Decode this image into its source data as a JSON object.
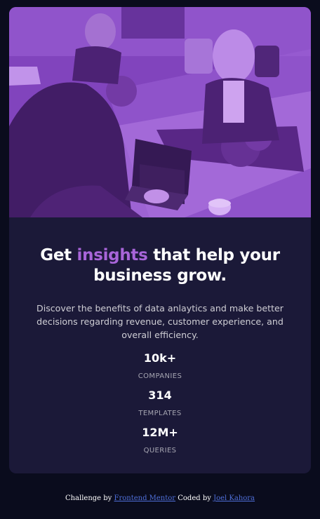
{
  "title": {
    "before": "Get ",
    "accent": "insights",
    "after": " that help your business grow."
  },
  "description": "Discover the benefits of data anlaytics and make better decisions regarding revenue, customer experience, and overall efficiency.",
  "stats": [
    {
      "value": "10k+",
      "label": "COMPANIES"
    },
    {
      "value": "314",
      "label": "TEMPLATES"
    },
    {
      "value": "12M+",
      "label": "QUERIES"
    }
  ],
  "attribution": {
    "prefix": "Challenge by ",
    "challenge_link": "Frontend Mentor",
    "middle": " Coded by ",
    "author_link": "Joel Kahora"
  },
  "colors": {
    "page_background": "#0a0c1d",
    "card_background": "#1b1938",
    "accent": "#a865d9",
    "image_overlay": "#6b3aa6",
    "link": "#4f6fd9"
  },
  "icons": {
    "hero": "office-meeting-photo"
  }
}
